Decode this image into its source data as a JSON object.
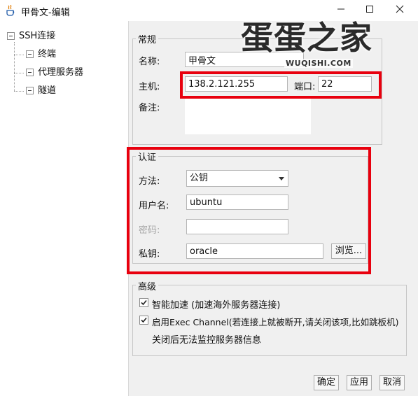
{
  "window": {
    "title": "甲骨文-编辑"
  },
  "tree": {
    "root": "SSH连接",
    "children": [
      "终端",
      "代理服务器",
      "隧道"
    ]
  },
  "general": {
    "title": "常规",
    "name_label": "名称:",
    "name_value": "甲骨文",
    "host_label": "主机:",
    "host_value": "138.2.121.255",
    "port_label": "端口:",
    "port_value": "22",
    "notes_label": "备注:"
  },
  "auth": {
    "title": "认证",
    "method_label": "方法:",
    "method_value": "公钥",
    "user_label": "用户名:",
    "user_value": "ubuntu",
    "password_label": "密码:",
    "password_value": "",
    "key_label": "私钥:",
    "key_value": "oracle",
    "browse_label": "浏览..."
  },
  "advanced": {
    "title": "高级",
    "smart_accel_label": "智能加速 (加速海外服务器连接)",
    "exec_channel_label": "启用Exec Channel(若连接上就被断开,请关闭该项,比如跳板机)",
    "exec_channel_note": "关闭后无法监控服务器信息"
  },
  "footer": {
    "ok": "确定",
    "apply": "应用",
    "cancel": "取消"
  },
  "watermark": {
    "main": "蛋蛋之家",
    "sub": "WUQISHI.COM"
  },
  "colors": {
    "highlight": "#e8000e"
  }
}
